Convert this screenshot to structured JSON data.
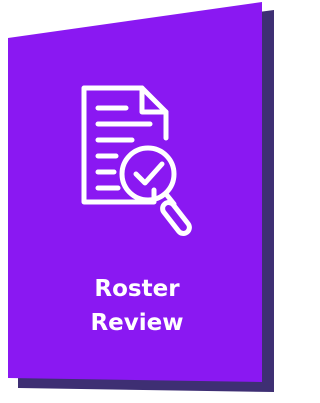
{
  "card": {
    "title_line1": "Roster",
    "title_line2": "Review",
    "icon": "document-search-checkmark-icon",
    "colors": {
      "face": "#8A18F2",
      "shadow": "#3E2F73",
      "icon_stroke": "#FFFFFF",
      "text": "#FFFFFF",
      "background": "#FFFFFF"
    }
  }
}
